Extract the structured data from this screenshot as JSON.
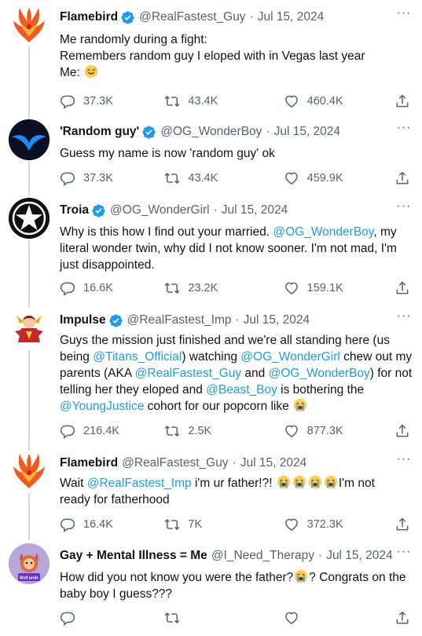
{
  "tweets": [
    {
      "name": "Flamebird",
      "verified": true,
      "handle": "@RealFastest_Guy",
      "dot": "·",
      "date": "Jul 15, 2024",
      "lines": [
        [
          {
            "t": "Me randomly during a fight:"
          }
        ],
        [
          {
            "t": "Remembers random guy I eloped with in Vegas last year"
          }
        ],
        [
          {
            "t": "Me: "
          },
          {
            "e": "grinning-sweat-emoji"
          }
        ]
      ],
      "replies": "37.3K",
      "retweets": "43.4K",
      "likes": "460.4K"
    },
    {
      "name": "'Random guy'",
      "verified": true,
      "handle": "@OG_WonderBoy",
      "dot": "·",
      "date": "Jul 15, 2024",
      "lines": [
        [
          {
            "t": "Guess my name is now 'random guy' ok"
          }
        ]
      ],
      "replies": "37.3K",
      "retweets": "43.4K",
      "likes": "459.9K"
    },
    {
      "name": "Troia",
      "verified": true,
      "handle": "@OG_WonderGirl",
      "dot": "·",
      "date": "Jul 15, 2024",
      "lines": [
        [
          {
            "t": "Why is this how I find out your married. "
          },
          {
            "m": "@OG_WonderBoy"
          },
          {
            "t": ", my"
          }
        ],
        [
          {
            "t": "literal wonder twin, why did I not know sooner. I'm not mad, I'm"
          }
        ],
        [
          {
            "t": "just disappointed."
          }
        ]
      ],
      "replies": "16.6K",
      "retweets": "23.2K",
      "likes": "159.1K"
    },
    {
      "name": "Impulse",
      "verified": true,
      "handle": "@RealFastest_Imp",
      "dot": "·",
      "date": "Jul 15, 2024",
      "lines": [
        [
          {
            "t": "Guys the mission just finished and we're all standing here (us"
          }
        ],
        [
          {
            "t": "being "
          },
          {
            "m": "@Titans_Official"
          },
          {
            "t": ") watching "
          },
          {
            "m": "@OG_WonderGirl"
          },
          {
            "t": " chew out my"
          }
        ],
        [
          {
            "t": "parents (AKA "
          },
          {
            "m": "@RealFastest_Guy"
          },
          {
            "t": " and "
          },
          {
            "m": "@OG_WonderBoy"
          },
          {
            "t": ") for not"
          }
        ],
        [
          {
            "t": "telling her they eloped and "
          },
          {
            "m": "@Beast_Boy"
          },
          {
            "t": " is bothering the"
          }
        ],
        [
          {
            "m": "@YoungJustice"
          },
          {
            "t": " cohort for our popcorn like "
          },
          {
            "e": "crying-emoji"
          }
        ]
      ],
      "replies": "216.4K",
      "retweets": "2.5K",
      "likes": "877.3K"
    },
    {
      "name": "Flamebird",
      "verified": false,
      "handle": "@RealFastest_Guy",
      "dot": "·",
      "date": "Jul 15, 2024",
      "lines": [
        [
          {
            "t": "Wait "
          },
          {
            "m": "@RealFastest_Imp"
          },
          {
            "t": " i'm ur father!?! "
          },
          {
            "e": "crying-emoji"
          },
          {
            "e": "crying-emoji"
          },
          {
            "e": "crying-emoji"
          },
          {
            "e": "crying-emoji"
          },
          {
            "t": "I'm not"
          }
        ],
        [
          {
            "t": "ready for fatherhood"
          }
        ]
      ],
      "replies": "16.4K",
      "retweets": "7K",
      "likes": "372.3K"
    },
    {
      "name": "Gay + Mental Illness = Me",
      "verified": false,
      "handle": "@I_Need_Therapy",
      "dot": "·",
      "date": "Jul 15, 2024",
      "avatar_caption": "Wolf pride",
      "lines": [
        [
          {
            "t": "How did you not know you were the father?"
          },
          {
            "e": "crying-emoji"
          },
          {
            "t": "? Congrats on the"
          }
        ],
        [
          {
            "t": "baby boy I guess???"
          }
        ]
      ],
      "replies": "",
      "retweets": "",
      "likes": ""
    }
  ],
  "more_glyph": "···",
  "colors": {
    "text": "#0f1419",
    "secondary": "#536471",
    "link": "#1d9bf0",
    "verified": "#1d9bf0",
    "thread_line": "#cfd9de"
  }
}
